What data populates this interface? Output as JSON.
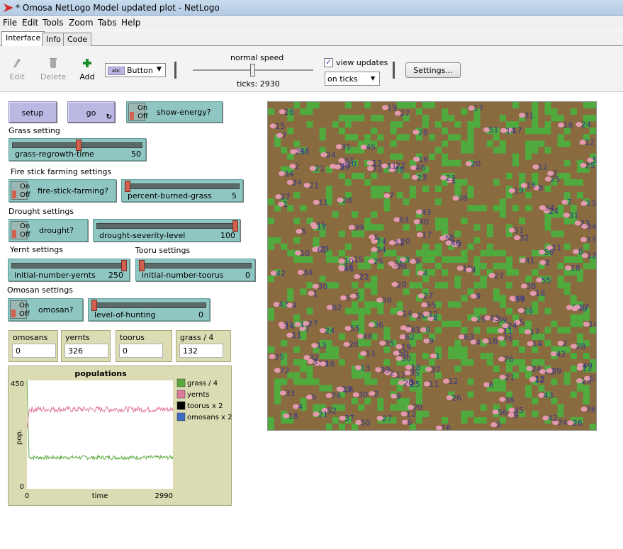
{
  "window": {
    "title": "* Omosa NetLogo Model updated plot - NetLogo"
  },
  "menu": [
    "File",
    "Edit",
    "Tools",
    "Zoom",
    "Tabs",
    "Help"
  ],
  "tabs": [
    "Interface",
    "Info",
    "Code"
  ],
  "toolbar": {
    "edit": "Edit",
    "delete": "Delete",
    "add": "Add",
    "widget_select": "Button",
    "speed_label": "normal speed",
    "ticks": "ticks: 2930",
    "view_updates": "view updates",
    "update_mode": "on ticks",
    "settings": "Settings..."
  },
  "buttons": {
    "setup": "setup",
    "go": "go"
  },
  "switches": {
    "show_energy": {
      "label": "show-energy?",
      "on": "On",
      "off": "Off"
    },
    "fire_stick": {
      "label": "fire-stick-farming?",
      "on": "On",
      "off": "Off"
    },
    "drought": {
      "label": "drought?",
      "on": "On",
      "off": "Off"
    },
    "omosan": {
      "label": "omosan?",
      "on": "On",
      "off": "Off"
    }
  },
  "notes": {
    "grass": "Grass setting",
    "fire": "Fire stick farming settings",
    "drought": "Drought settings",
    "yernt": "Yernt settings",
    "tooru": "Tooru settings",
    "omosan": "Omosan settings"
  },
  "sliders": {
    "grass_regrowth": {
      "name": "grass-regrowth-time",
      "value": "50",
      "fraction": 0.5
    },
    "percent_burned": {
      "name": "percent-burned-grass",
      "value": "5",
      "fraction": 0.0
    },
    "drought_severity": {
      "name": "drought-severity-level",
      "value": "100",
      "fraction": 1.0
    },
    "initial_yernts": {
      "name": "initial-number-yernts",
      "value": "250",
      "fraction": 1.0
    },
    "initial_toorus": {
      "name": "initial-number-toorus",
      "value": "0",
      "fraction": 0.0
    },
    "level_hunting": {
      "name": "level-of-hunting",
      "value": "0",
      "fraction": 0.0
    }
  },
  "monitors": [
    {
      "label": "omosans",
      "value": "0"
    },
    {
      "label": "yernts",
      "value": "326"
    },
    {
      "label": "toorus",
      "value": "0"
    },
    {
      "label": "grass / 4",
      "value": "132"
    }
  ],
  "chart_data": {
    "type": "line",
    "title": "populations",
    "xlabel": "time",
    "ylabel": "pop.",
    "xlim": [
      0,
      2990
    ],
    "ylim": [
      0,
      450
    ],
    "x_ticks": [
      "0",
      "2990"
    ],
    "y_ticks": [
      "0",
      "450"
    ],
    "legend_position": "right",
    "series": [
      {
        "name": "grass / 4",
        "color": "#5aab3c",
        "start": 450,
        "level": 130,
        "noise": 8
      },
      {
        "name": "yernts",
        "color": "#df7b9c",
        "start": 250,
        "level": 330,
        "noise": 12
      },
      {
        "name": "toorus x 2",
        "color": "#000000",
        "level": 0
      },
      {
        "name": "omosans x 2",
        "color": "#3f6cc4",
        "level": 0
      }
    ]
  },
  "world": {
    "grass_color": "#4fab3e",
    "dirt_color": "#8a6a3f",
    "turtle_color": "#e39ab0",
    "turtle_labels": [
      "38",
      "20",
      "21",
      "13",
      "14",
      "12",
      "18",
      "10",
      "4",
      "49",
      "16",
      "8",
      "3",
      "15",
      "56",
      "51",
      "45",
      "28",
      "43",
      "35",
      "6",
      "24",
      "22",
      "26",
      "19",
      "62",
      "74",
      "42",
      "5",
      "72",
      "1",
      "18",
      "4",
      "26",
      "23",
      "27",
      "31",
      "9",
      "11",
      "25",
      "63",
      "19",
      "55",
      "14",
      "12",
      "17",
      "34",
      "39",
      "46",
      "13",
      "1",
      "7",
      "50",
      "20",
      "9",
      "12",
      "24",
      "37",
      "2",
      "27",
      "30",
      "34",
      "36",
      "11",
      "33",
      "31",
      "40",
      "41",
      "43",
      "52",
      "32",
      "25",
      "76",
      "2",
      "5",
      "39",
      "3",
      "7",
      "21",
      "18",
      "17",
      "29"
    ]
  }
}
